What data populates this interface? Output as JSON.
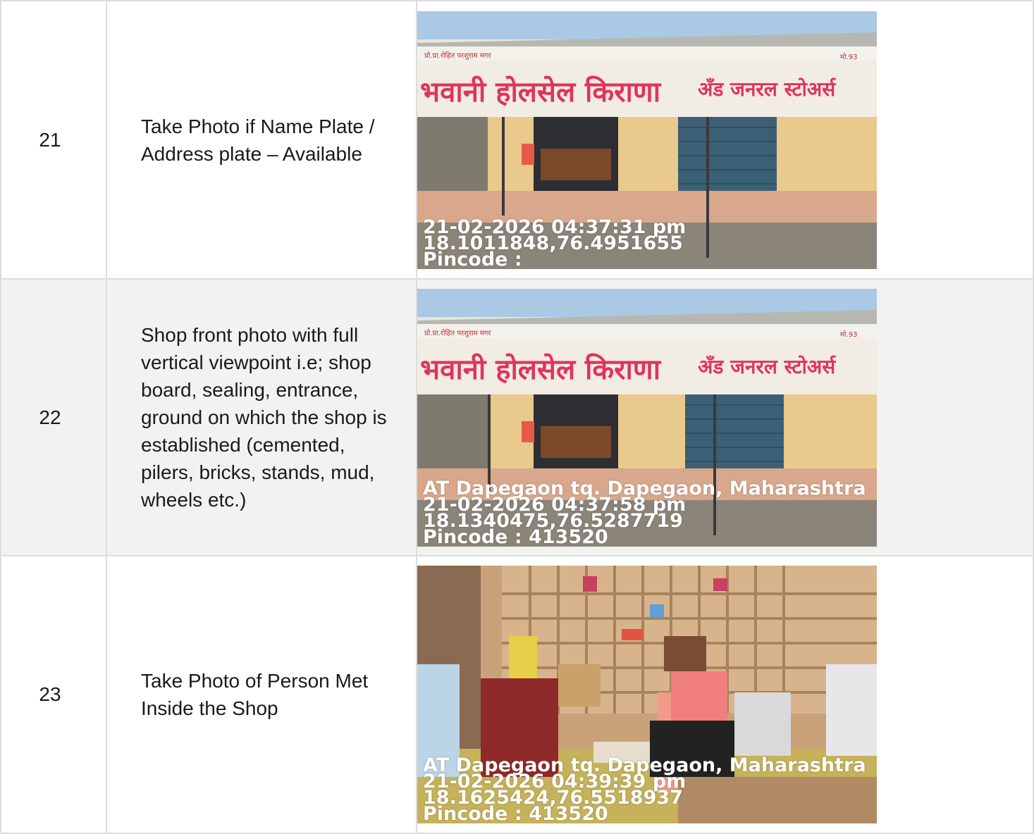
{
  "rows": [
    {
      "number": "21",
      "description": "Take Photo if Name Plate / Address plate – Available",
      "photo": {
        "scene": "shop-front",
        "sign_owner": "प्रो.प्रा.रोहित परशुराम मगर",
        "sign_main": "भवानी होलसेल किराणा",
        "sign_sub": "अँड जनरल स्टोअर्स",
        "sign_phone": "मो.93",
        "stamp_address": "",
        "stamp_datetime": "21-02-2026 04:37:31 pm",
        "stamp_coords": "18.1011848,76.4951655",
        "stamp_pincode": "Pincode :"
      }
    },
    {
      "number": "22",
      "description": "Shop front photo with full vertical viewpoint i.e; shop board, sealing, entrance, ground on which the shop is established (cemented, pilers, bricks, stands, mud, wheels etc.)",
      "photo": {
        "scene": "shop-front",
        "sign_owner": "प्रो.प्रा.रोहित परशुराम मगर",
        "sign_main": "भवानी होलसेल किराणा",
        "sign_sub": "अँड जनरल स्टोअर्स",
        "sign_phone": "मो.93",
        "stamp_address": "AT Dapegaon tq. Dapegaon, Maharashtra",
        "stamp_datetime": "21-02-2026 04:37:58 pm",
        "stamp_coords": "18.1340475,76.5287719",
        "stamp_pincode": "Pincode : 413520"
      }
    },
    {
      "number": "23",
      "description": "Take Photo of Person Met Inside the Shop",
      "photo": {
        "scene": "shop-interior",
        "stamp_address": "AT Dapegaon tq. Dapegaon, Maharashtra",
        "stamp_datetime": "21-02-2026 04:39:39 pm",
        "stamp_coords": "18.1625424,76.5518937",
        "stamp_pincode": "Pincode : 413520"
      }
    }
  ]
}
